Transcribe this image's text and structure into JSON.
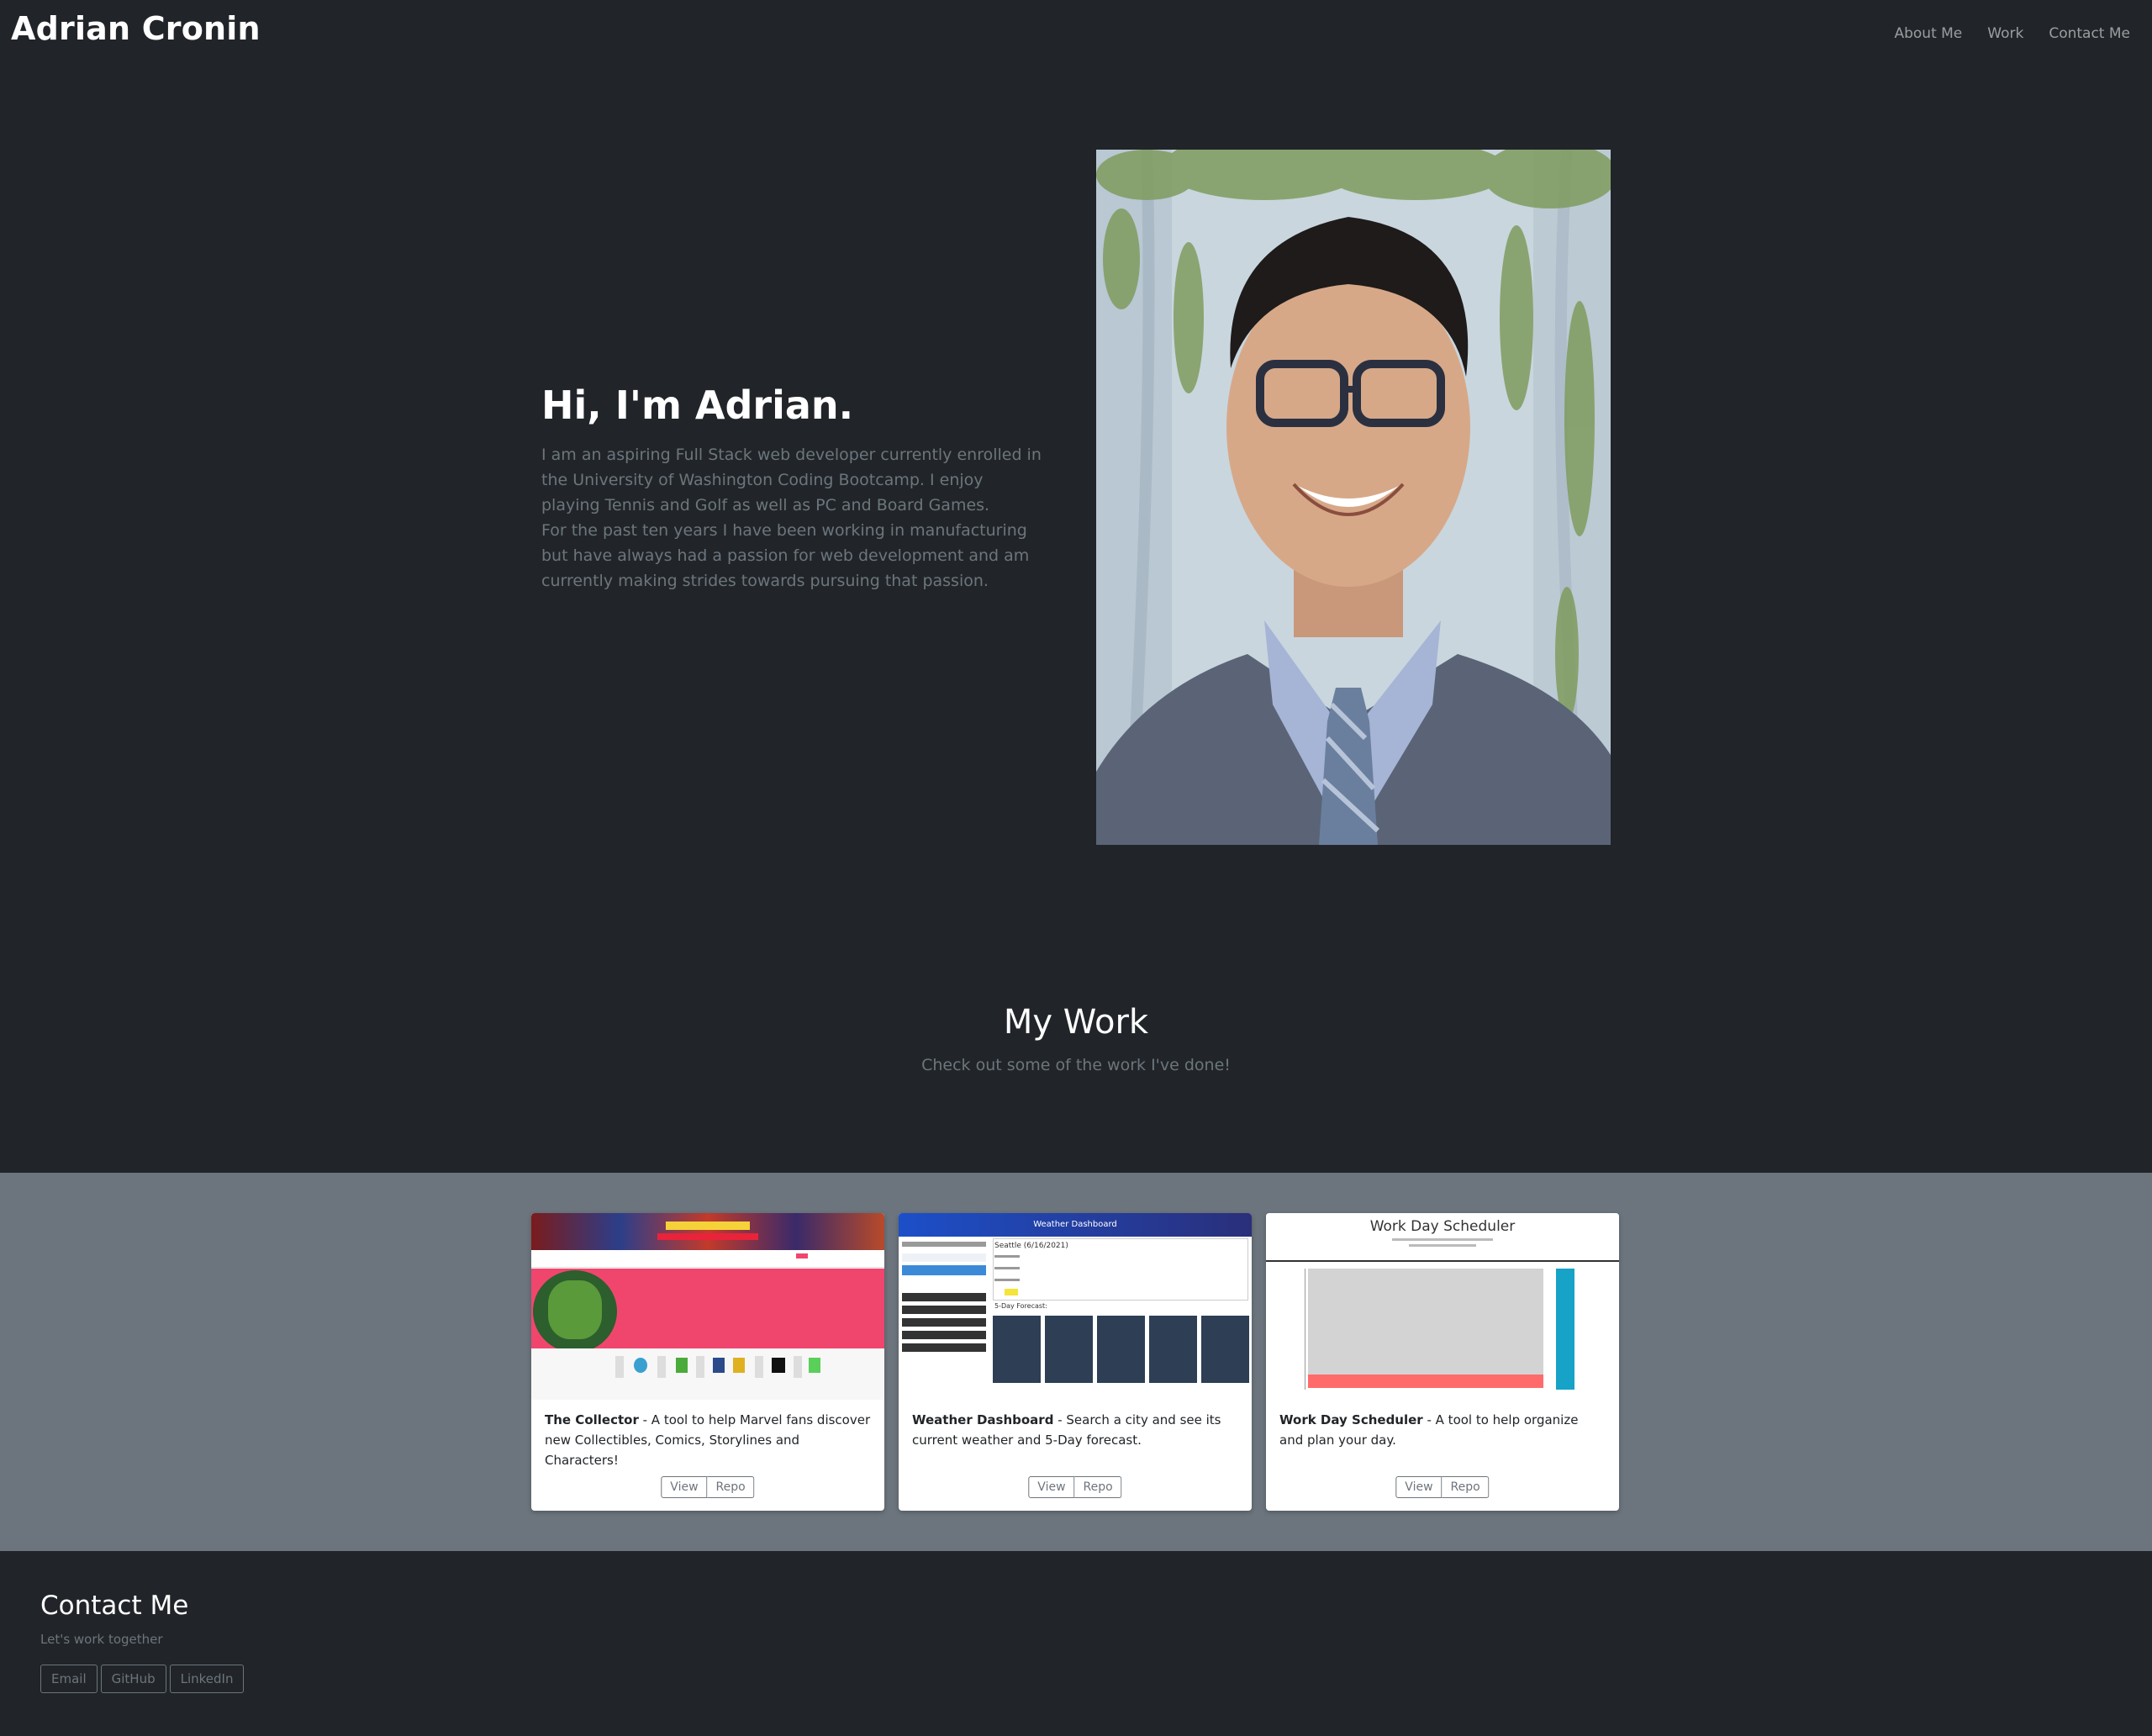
{
  "navbar": {
    "brand": "Adrian Cronin",
    "links": [
      "About Me",
      "Work",
      "Contact Me"
    ]
  },
  "hero": {
    "title": "Hi, I'm Adrian.",
    "paragraph1": "I am an aspiring Full Stack web developer currently enrolled in the University of Washington Coding Bootcamp. I enjoy playing Tennis and Golf as well as PC and Board Games.",
    "paragraph2": "For the past ten years I have been working in manufacturing but have always had a passion for web development and am currently making strides towards pursuing that passion."
  },
  "work": {
    "title": "My Work",
    "subtitle": "Check out some of the work I've done!",
    "projects": [
      {
        "name": "The Collector",
        "description": " - A tool to help Marvel fans discover new Collectibles, Comics, Storylines and Characters!",
        "view_label": "View",
        "repo_label": "Repo"
      },
      {
        "name": "Weather Dashboard",
        "description": " - Search a city and see its current weather and 5-Day forecast.",
        "view_label": "View",
        "repo_label": "Repo",
        "preview_header": "Weather Dashboard",
        "preview_city": "Seattle (6/16/2021)",
        "preview_forecast": "5-Day Forecast:"
      },
      {
        "name": "Work Day Scheduler",
        "description": " - A tool to help organize and plan your day.",
        "view_label": "View",
        "repo_label": "Repo",
        "preview_header": "Work Day Scheduler"
      }
    ]
  },
  "contact": {
    "title": "Contact Me",
    "subtitle": "Let's work together",
    "buttons": [
      "Email",
      "GitHub",
      "LinkedIn"
    ]
  },
  "colors": {
    "background": "#212529",
    "band": "#6c757d",
    "muted": "#6c757d",
    "collector_pink": "#f0466e",
    "weather_navy": "#2d3e55",
    "scheduler_cyan": "#17a2c8",
    "scheduler_red": "#ff6b6b"
  }
}
